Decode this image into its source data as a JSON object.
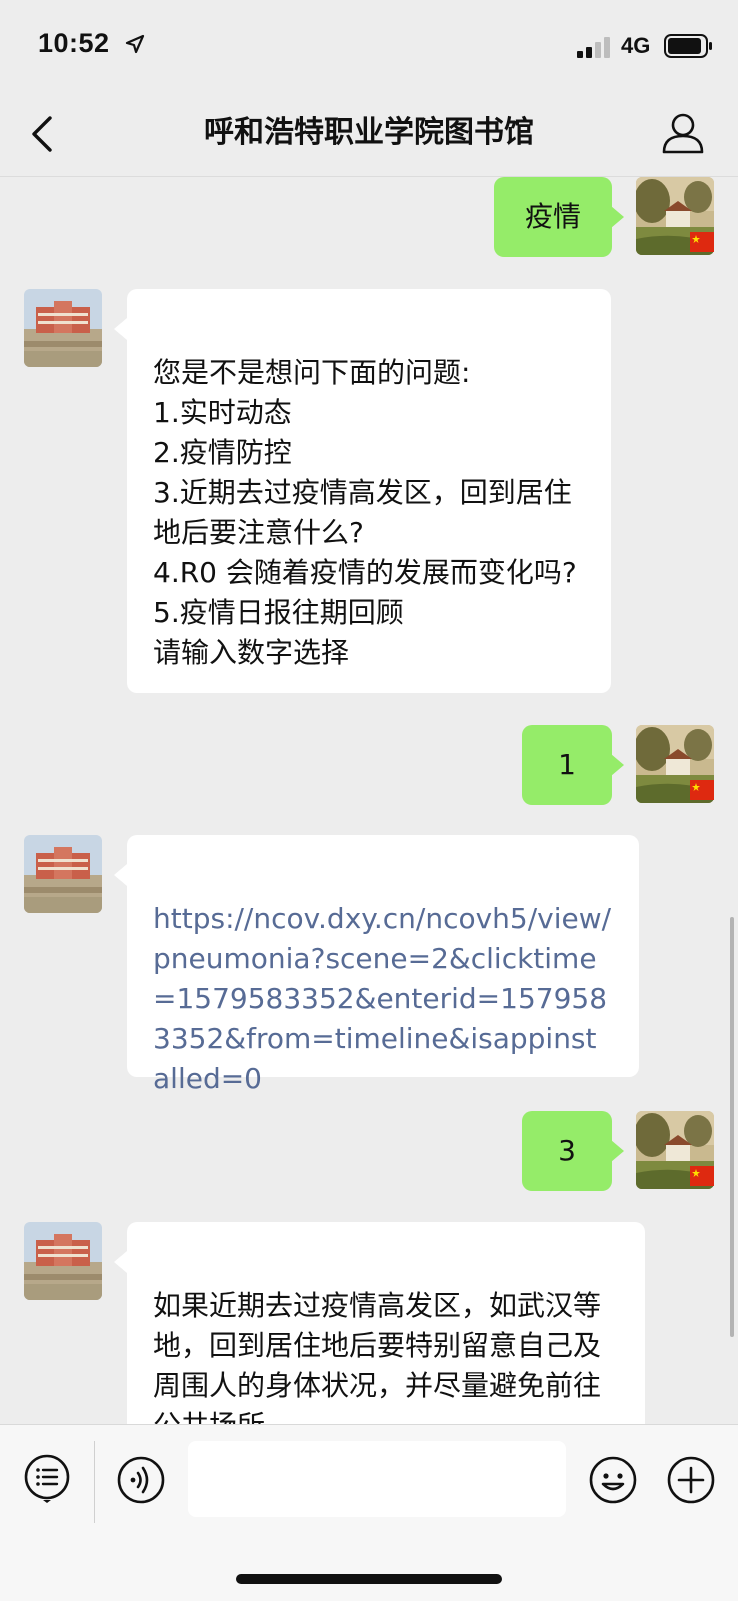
{
  "status_bar": {
    "time": "10:52",
    "network": "4G"
  },
  "header": {
    "title": "呼和浩特职业学院图书馆"
  },
  "messages": [
    {
      "sender": "me",
      "text": "疫情"
    },
    {
      "sender": "library",
      "text": "您是不是想问下面的问题:\n1.实时动态\n2.疫情防控\n3.近期去过疫情高发区，回到居住地后要注意什么?\n4.R0 会随着疫情的发展而变化吗?\n5.疫情日报往期回顾\n请输入数字选择"
    },
    {
      "sender": "me",
      "text": "1"
    },
    {
      "sender": "library",
      "text": "https://ncov.dxy.cn/ncovh5/view/pneumonia?scene=2&clicktime=1579583352&enterid=1579583352&from=timeline&isappinstalled=0"
    },
    {
      "sender": "me",
      "text": "3"
    },
    {
      "sender": "library",
      "text": "如果近期去过疫情高发区，如武汉等地，回到居住地后要特别留意自己及周围人的身体状况，并尽量避免前往公共场所"
    }
  ],
  "input_bar": {
    "text_value": ""
  },
  "colors": {
    "outgoing_bubble": "#95ec69",
    "incoming_bubble": "#ffffff",
    "link": "#576b95",
    "background": "#ededed"
  },
  "icons": {
    "back": "chevron-left-icon",
    "profile": "person-icon",
    "menu": "list-menu-icon",
    "voice": "voice-icon",
    "emoji": "emoji-icon",
    "add": "plus-icon"
  }
}
